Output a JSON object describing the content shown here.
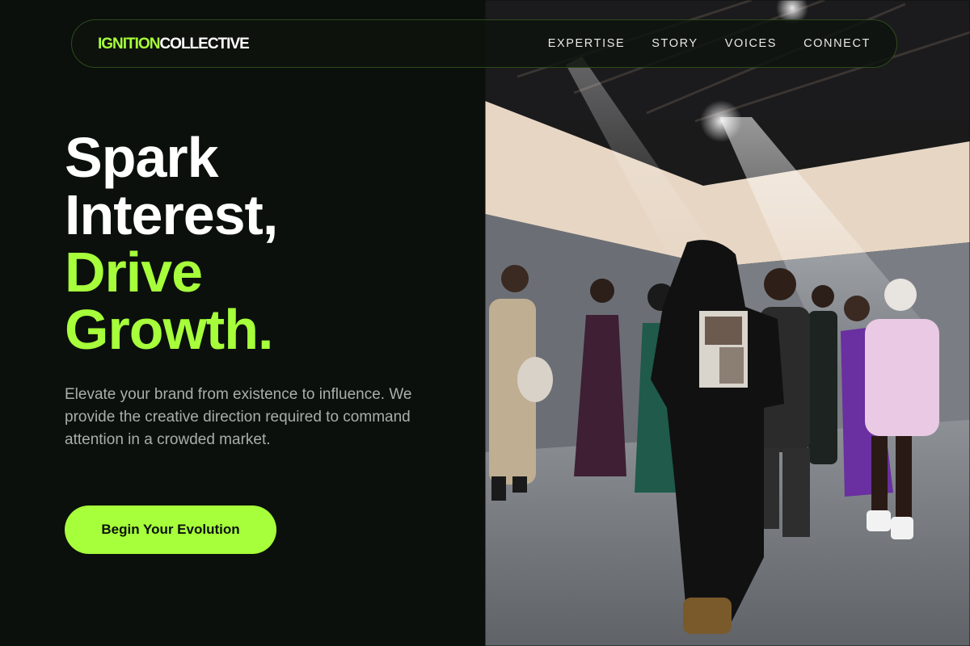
{
  "brand": {
    "part1": "IGNITION",
    "part2": "COLLECTIVE",
    "accent_color": "#a6ff3a"
  },
  "nav": {
    "links": [
      "EXPERTISE",
      "STORY",
      "VOICES",
      "CONNECT"
    ]
  },
  "hero": {
    "headline_line1": "Spark",
    "headline_line2": "Interest,",
    "headline_line3": "Drive",
    "headline_line4": "Growth.",
    "subtext": "Elevate your brand from existence to influence. We provide the creative direction required to command attention in a crowded market.",
    "cta_label": "Begin Your Evolution"
  },
  "colors": {
    "background": "#0b100c",
    "accent": "#a6ff3a",
    "text_primary": "#ffffff",
    "text_secondary": "#a9aea9"
  }
}
